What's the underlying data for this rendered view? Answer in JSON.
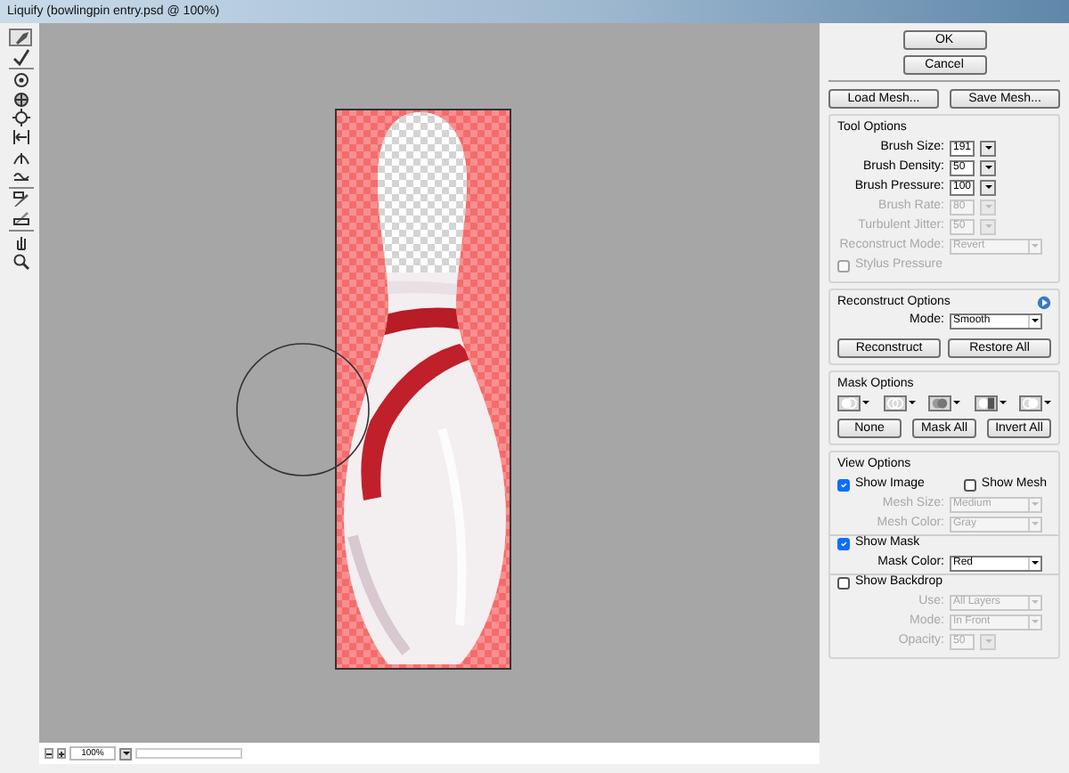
{
  "window": {
    "title": "Liquify (bowlingpin entry.psd @ 100%)"
  },
  "tools": [
    {
      "selected": true
    },
    {
      "selected": false
    },
    {
      "selected": false
    },
    {
      "selected": false
    },
    {
      "selected": false
    },
    {
      "selected": false
    },
    {
      "selected": false
    },
    {
      "selected": false
    },
    {
      "selected": false
    },
    {
      "selected": false
    },
    {
      "selected": false
    },
    {
      "selected": false
    }
  ],
  "zoom": {
    "value": "100%"
  },
  "dialog_buttons": [
    {
      "label": "OK"
    },
    {
      "label": "Cancel"
    }
  ],
  "mesh_buttons": [
    {
      "label": "Load Mesh..."
    },
    {
      "label": "Save Mesh..."
    }
  ],
  "tool_options": {
    "title": "Tool Options",
    "fields": [
      {
        "kind": "spin",
        "label": "Brush Size:",
        "value": "191",
        "disabled": false
      },
      {
        "kind": "spin",
        "label": "Brush Density:",
        "value": "50",
        "disabled": false
      },
      {
        "kind": "spin",
        "label": "Brush Pressure:",
        "value": "100",
        "disabled": false
      },
      {
        "kind": "spin",
        "label": "Brush Rate:",
        "value": "80",
        "disabled": true
      },
      {
        "kind": "spin",
        "label": "Turbulent Jitter:",
        "value": "50",
        "disabled": true
      },
      {
        "kind": "select",
        "label": "Reconstruct Mode:",
        "value": "Revert",
        "disabled": true
      },
      {
        "kind": "check",
        "label": "Stylus Pressure",
        "checked": false,
        "disabled": true
      }
    ]
  },
  "reconstruct_options": {
    "title": "Reconstruct Options",
    "mode": {
      "kind": "select",
      "label": "Mode:",
      "value": "Smooth",
      "disabled": false
    },
    "buttons": [
      {
        "label": "Reconstruct"
      },
      {
        "label": "Restore All"
      }
    ]
  },
  "mask_options": {
    "title": "Mask Options",
    "buttons": [
      {
        "label": "None"
      },
      {
        "label": "Mask All"
      },
      {
        "label": "Invert All"
      }
    ]
  },
  "view_options": {
    "title": "View Options",
    "fields": [
      {
        "kind": "checks",
        "checks": [
          {
            "label": "Show Image",
            "checked": true,
            "disabled": false
          },
          {
            "label": "Show Mesh",
            "checked": false,
            "disabled": false
          }
        ]
      },
      {
        "kind": "select",
        "label": "Mesh Size:",
        "value": "Medium",
        "disabled": true
      },
      {
        "kind": "select",
        "label": "Mesh Color:",
        "value": "Gray",
        "disabled": true
      },
      {
        "kind": "check",
        "label": "Show Mask",
        "checked": true,
        "disabled": false
      },
      {
        "kind": "select",
        "label": "Mask Color:",
        "value": "Red",
        "disabled": false
      },
      {
        "kind": "check",
        "label": "Show Backdrop",
        "checked": false,
        "disabled": false
      },
      {
        "kind": "select",
        "label": "Use:",
        "value": "All Layers",
        "disabled": true
      },
      {
        "kind": "select",
        "label": "Mode:",
        "value": "In Front",
        "disabled": true
      },
      {
        "kind": "spin",
        "label": "Opacity:",
        "value": "50",
        "disabled": true
      }
    ]
  }
}
